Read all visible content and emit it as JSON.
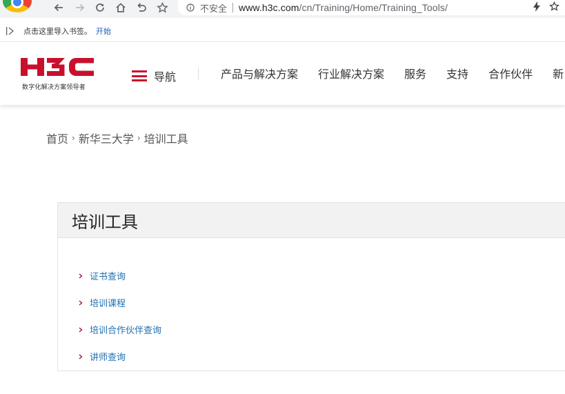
{
  "browser": {
    "security_label": "不安全",
    "url_host": "www.h3c.com",
    "url_path": "/cn/Training/Home/Training_Tools/",
    "bookmarks_prompt": "点击这里导入书签。",
    "bookmarks_start": "开始"
  },
  "site": {
    "brand": "H3C",
    "tagline": "数字化解决方案领导者",
    "nav_label": "导航",
    "nav_items": [
      "产品与解决方案",
      "行业解决方案",
      "服务",
      "支持",
      "合作伙伴",
      "新"
    ],
    "brand_color": "#c8102e"
  },
  "breadcrumb": [
    "首页",
    "新华三大学",
    "培训工具"
  ],
  "panel": {
    "title": "培训工具",
    "links": [
      "证书查询",
      "培训课程",
      "培训合作伙伴查询",
      "讲师查询"
    ]
  }
}
